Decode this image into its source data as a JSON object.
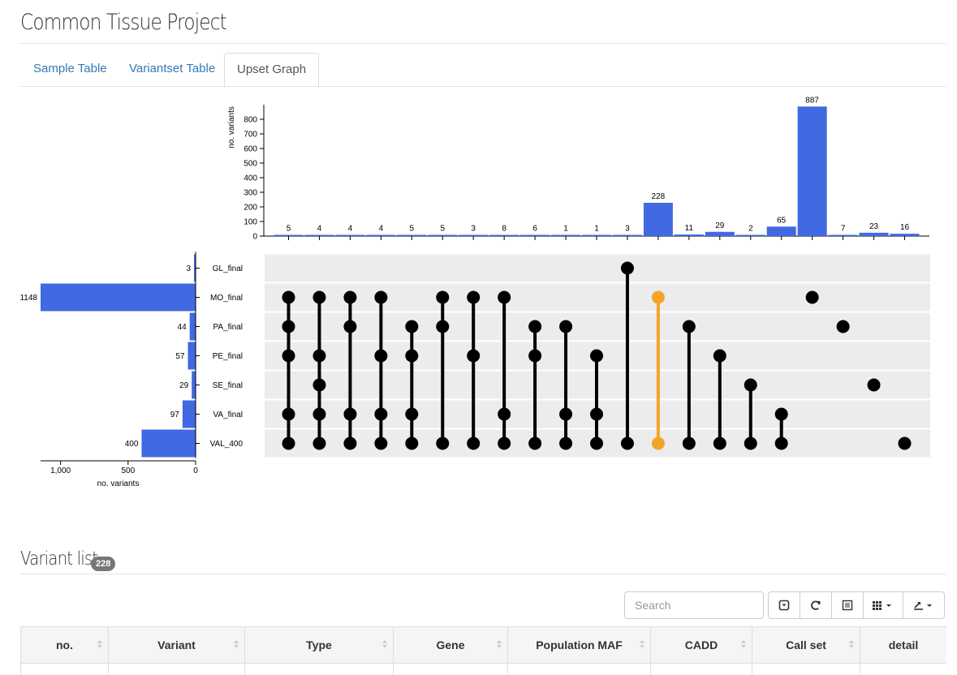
{
  "header": {
    "title": "Common Tissue Project"
  },
  "tabs": [
    {
      "label": "Sample Table",
      "active": false
    },
    {
      "label": "Variantset Table",
      "active": false
    },
    {
      "label": "Upset Graph",
      "active": true
    }
  ],
  "chart_data": {
    "type": "bar",
    "intersection_axis_label": "no. variants",
    "set_axis_label": "no. variants",
    "intersection_ylim": [
      0,
      900
    ],
    "intersection_ticks": [
      "0",
      "100",
      "200",
      "300",
      "400",
      "500",
      "600",
      "700",
      "800"
    ],
    "set_ticks": [
      "1,000",
      "500",
      "0"
    ],
    "sets": [
      {
        "name": "GL_final",
        "size": 3
      },
      {
        "name": "MO_final",
        "size": 1148
      },
      {
        "name": "PA_final",
        "size": 44
      },
      {
        "name": "PE_final",
        "size": 57
      },
      {
        "name": "SE_final",
        "size": 29
      },
      {
        "name": "VA_final",
        "size": 97
      },
      {
        "name": "VAL_400",
        "size": 400
      }
    ],
    "intersections": [
      {
        "count": 5,
        "sets": [
          1,
          2,
          3,
          5,
          6
        ]
      },
      {
        "count": 4,
        "sets": [
          1,
          3,
          4,
          5,
          6
        ]
      },
      {
        "count": 4,
        "sets": [
          1,
          2,
          5,
          6
        ]
      },
      {
        "count": 4,
        "sets": [
          1,
          3,
          5,
          6
        ]
      },
      {
        "count": 5,
        "sets": [
          2,
          3,
          5,
          6
        ]
      },
      {
        "count": 5,
        "sets": [
          1,
          2,
          6
        ]
      },
      {
        "count": 3,
        "sets": [
          1,
          3,
          6
        ]
      },
      {
        "count": 8,
        "sets": [
          1,
          5,
          6
        ]
      },
      {
        "count": 6,
        "sets": [
          2,
          3,
          6
        ]
      },
      {
        "count": 1,
        "sets": [
          2,
          5,
          6
        ]
      },
      {
        "count": 1,
        "sets": [
          3,
          5,
          6
        ]
      },
      {
        "count": 3,
        "sets": [
          0,
          6
        ]
      },
      {
        "count": 228,
        "sets": [
          1,
          6
        ],
        "highlight": true
      },
      {
        "count": 11,
        "sets": [
          2,
          6
        ]
      },
      {
        "count": 29,
        "sets": [
          3,
          6
        ]
      },
      {
        "count": 2,
        "sets": [
          4,
          6
        ]
      },
      {
        "count": 65,
        "sets": [
          5,
          6
        ]
      },
      {
        "count": 887,
        "sets": [
          1
        ]
      },
      {
        "count": 7,
        "sets": [
          2
        ]
      },
      {
        "count": 23,
        "sets": [
          4
        ]
      },
      {
        "count": 16,
        "sets": [
          6
        ]
      }
    ],
    "colors": {
      "bar": "#4169e1",
      "dot": "#000000",
      "highlight": "#f5a42a",
      "band": "#ececec"
    }
  },
  "variant_list": {
    "title": "Variant list",
    "count": "228"
  },
  "search": {
    "placeholder": "Search"
  },
  "toolbar_icons": [
    "toggle-pagination-icon",
    "refresh-icon",
    "toggle-view-icon",
    "columns-icon",
    "export-icon"
  ],
  "table": {
    "columns": [
      "no.",
      "Variant",
      "Type",
      "Gene",
      "Population MAF",
      "CADD",
      "Call set",
      "detail"
    ]
  }
}
